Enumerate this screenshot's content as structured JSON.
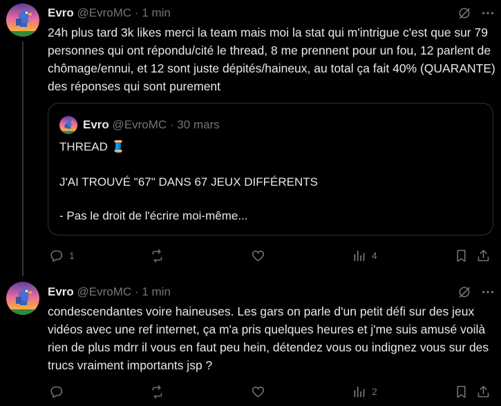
{
  "colors": {
    "background": "#000000",
    "text_primary": "#e7e9ea",
    "text_secondary": "#71767b",
    "border": "#2f3336"
  },
  "tweets": [
    {
      "name": "Evro",
      "handle": "@EvroMC",
      "separator": "·",
      "time": "1 min",
      "avatar": "pixel-bird-sunset-avatar",
      "text": "24h plus tard 3k likes merci la team mais moi la stat qui m'intrigue c'est que sur 79 personnes qui ont répondu/cité le thread, 8 me prennent pour un fou, 12 parlent de chômage/ennui, et 12 sont juste dépités/haineux, au total ça fait 40% (QUARANTE) des réponses qui sont purement",
      "quote": {
        "name": "Evro",
        "handle": "@EvroMC",
        "separator": "·",
        "date": "30 mars",
        "line1": "THREAD 🧵",
        "line2": "J'AI TROUVÉ \"67\" DANS 67 JEUX DIFFÉRENTS",
        "line3": "- Pas le droit de l'écrire moi-même..."
      },
      "actions": {
        "replies": "1",
        "retweets": "",
        "likes": "",
        "views": "4"
      }
    },
    {
      "name": "Evro",
      "handle": "@EvroMC",
      "separator": "·",
      "time": "1 min",
      "avatar": "pixel-bird-sunset-avatar",
      "text": "condescendantes voire haineuses. Les gars on parle d'un petit défi sur des jeux vidéos avec une ref internet, ça m'a pris quelques heures et j'me suis amusé voilà rien de plus mdrr il vous en faut peu hein, détendez vous ou indignez vous sur des trucs vraiment importants jsp ?",
      "actions": {
        "replies": "",
        "retweets": "",
        "likes": "",
        "views": "2"
      }
    }
  ]
}
